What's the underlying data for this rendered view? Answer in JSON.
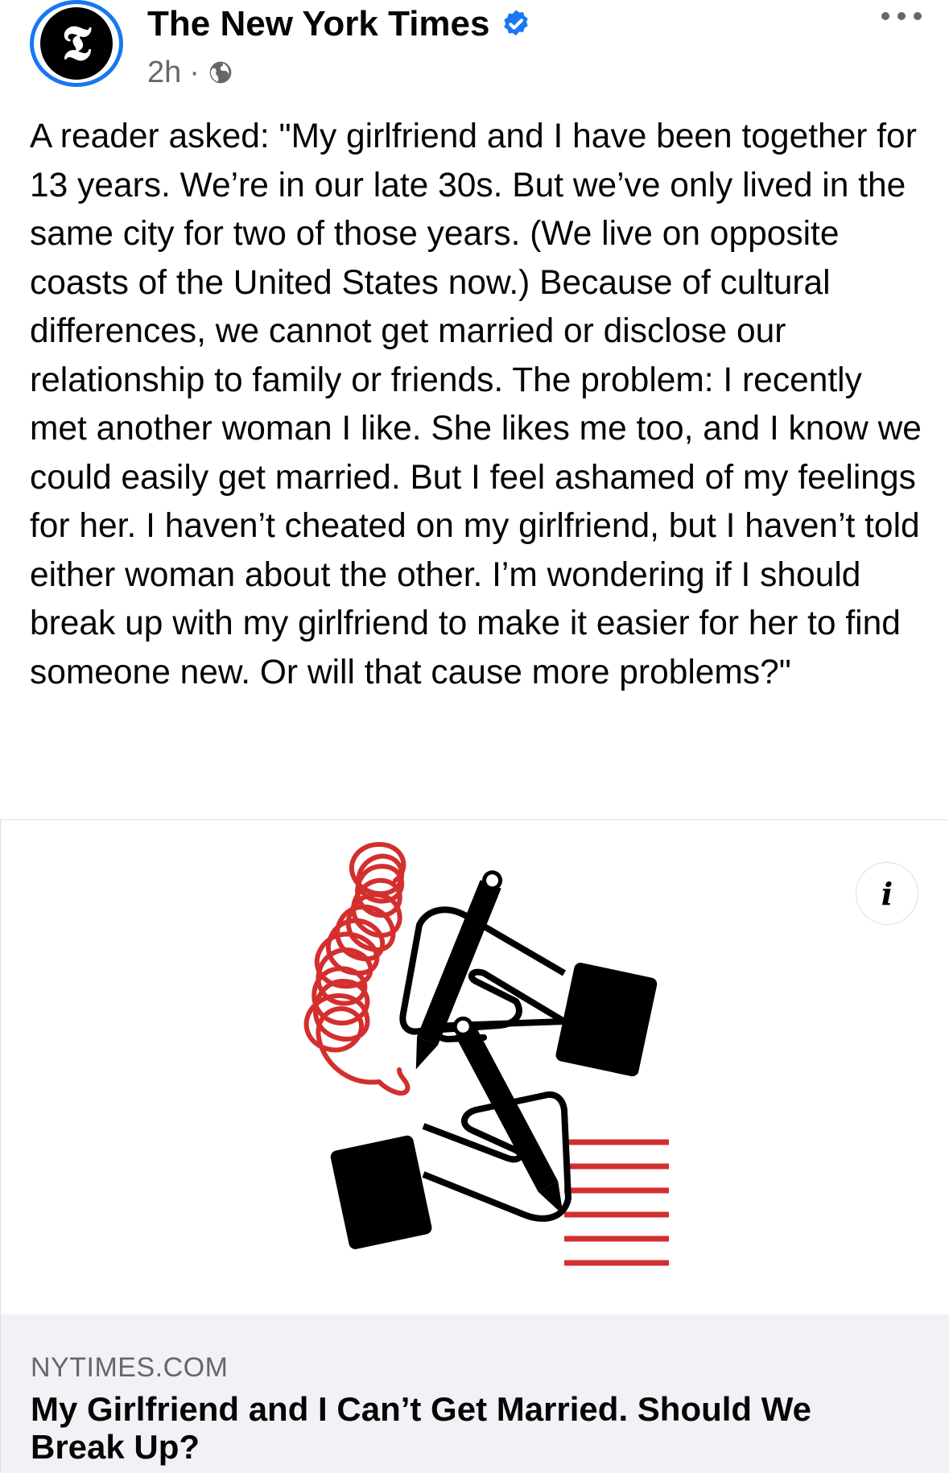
{
  "post": {
    "page_name": "The New York Times",
    "time": "2h",
    "separator": "·",
    "text": "A reader asked: \"My girlfriend and I have been together for 13 years. We’re in our late 30s. But we’ve only lived in the same city for two of those years. (We live on opposite coasts of the United States now.) Because of cultural differences, we cannot get married or disclose our relationship to family or friends. The problem: I recently met another woman I like. She likes me too, and I know we could easily get married. But I feel ashamed of my feelings for her. I haven’t cheated on my girlfriend, but I haven’t told either woman about the other. I’m wondering if I should break up with my girlfriend to make it easier for her to find someone new. Or will that cause more problems?\"",
    "avatar_glyph": "𝕿"
  },
  "link_card": {
    "domain": "NYTIMES.COM",
    "title": "My Girlfriend and I Can’t Get Married. Should We Break Up?",
    "info_glyph": "i"
  },
  "colors": {
    "verified": "#1877f2",
    "accent_red": "#d32f2f",
    "secondary_text": "#65676b"
  },
  "icons": [
    "avatar-logo",
    "verified-badge-icon",
    "globe-icon",
    "more-options-icon",
    "info-icon"
  ]
}
